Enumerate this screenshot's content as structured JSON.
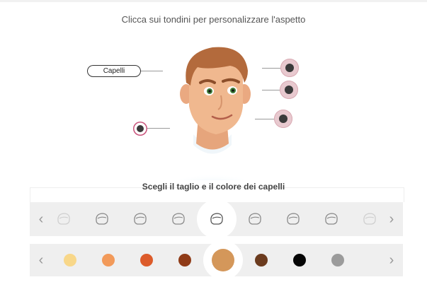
{
  "instruction": "Clicca sui tondini per personalizzare l'aspetto",
  "hair_label": "Capelli",
  "section_title": "Scegli il taglio e il colore dei capelli",
  "arrows": {
    "left": "‹",
    "right": "›"
  },
  "hair_styles": [
    "hair-style-1",
    "hair-style-2",
    "hair-style-3",
    "hair-style-4",
    "hair-style-5",
    "hair-style-6",
    "hair-style-7",
    "hair-style-8",
    "hair-style-9"
  ],
  "hair_selected_index": 4,
  "colors": {
    "swatches": [
      "#f8d789",
      "#f29a5a",
      "#dc5b2a",
      "#8f3b17",
      "#d4975a",
      "#6b3b1e",
      "#050505",
      "#9b9b9b"
    ],
    "selected_index": 4,
    "skin": "#f0b88f",
    "hair": "#b36a3c",
    "shirt": "#a8d4ea",
    "hotspot_ring": "#c8527a"
  }
}
